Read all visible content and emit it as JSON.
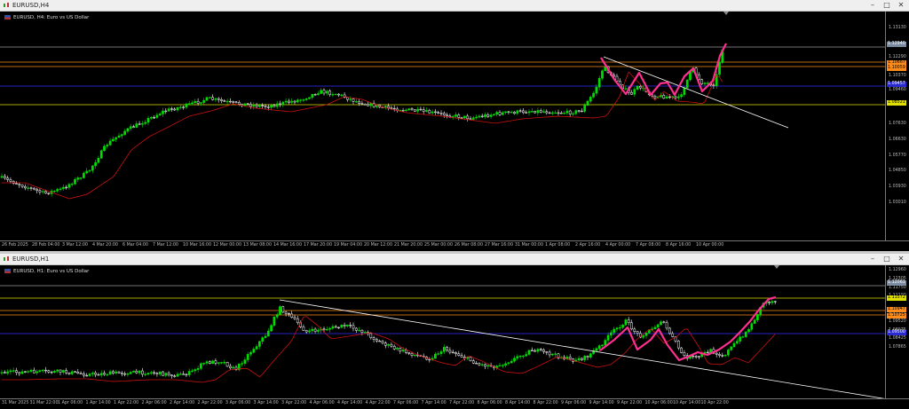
{
  "windows": [
    {
      "title": "EURUSD,H4",
      "legend": "EURUSD, H4: Euro vs US Dollar",
      "yticks": [
        "1.13130",
        "1.12290",
        "1.10370",
        "1.09460",
        "1.07630",
        "1.06630",
        "1.05770",
        "1.04850",
        "1.03930",
        "1.03010"
      ],
      "price_tags": [
        {
          "text": "1.12940",
          "bg": "#7a8aa0",
          "fg": "#ffffff"
        },
        {
          "text": "1.10667",
          "bg": "#ff8c1a",
          "fg": "#000000"
        },
        {
          "text": "1.10059",
          "bg": "#ff8c1a",
          "fg": "#000000"
        },
        {
          "text": "1.09457",
          "bg": "#2a2ad0",
          "fg": "#ffffff"
        },
        {
          "text": "1.08521",
          "bg": "#e0e000",
          "fg": "#000000"
        }
      ],
      "xticks": [
        "26 Feb 2025",
        "28 Feb 04:00",
        "3 Mar 12:00",
        "4 Mar 20:00",
        "6 Mar 04:00",
        "7 Mar 12:00",
        "10 Mar 16:00",
        "12 Mar 00:00",
        "13 Mar 08:00",
        "14 Mar 16:00",
        "17 Mar 20:00",
        "19 Mar 04:00",
        "20 Mar 12:00",
        "21 Mar 20:00",
        "25 Mar 00:00",
        "26 Mar 08:00",
        "27 Mar 16:00",
        "31 Mar 00:00",
        "1 Apr 08:00",
        "2 Apr 16:00",
        "4 Apr 00:00",
        "7 Apr 08:00",
        "8 Apr 16:00",
        "10 Apr 00:00"
      ]
    },
    {
      "title": "EURUSD,H1",
      "legend": "EURUSD, H1: Euro vs US Dollar",
      "yticks": [
        "1.12960",
        "1.12305",
        "1.11750",
        "1.11190",
        "1.10000",
        "1.09520",
        "1.08975",
        "1.08425",
        "1.07865"
      ],
      "price_tags": [
        {
          "text": "1.12061",
          "bg": "#7a8aa0",
          "fg": "#ffffff"
        },
        {
          "text": "1.11572",
          "bg": "#e0e000",
          "fg": "#000000"
        },
        {
          "text": "1.10947",
          "bg": "#ff8c1a",
          "fg": "#000000"
        },
        {
          "text": "1.10725",
          "bg": "#ff8c1a",
          "fg": "#000000"
        },
        {
          "text": "1.09500",
          "bg": "#2a2ad0",
          "fg": "#ffffff"
        }
      ],
      "xticks": [
        "31 Mar 2025",
        "31 Mar 22:00",
        "1 Apr 06:00",
        "1 Apr 14:00",
        "1 Apr 22:00",
        "2 Apr 06:00",
        "2 Apr 14:00",
        "2 Apr 22:00",
        "3 Apr 06:00",
        "3 Apr 14:00",
        "3 Apr 22:00",
        "4 Apr 06:00",
        "4 Apr 14:00",
        "4 Apr 22:00",
        "7 Apr 06:00",
        "7 Apr 14:00",
        "7 Apr 22:00",
        "8 Apr 06:00",
        "8 Apr 14:00",
        "8 Apr 22:00",
        "9 Apr 06:00",
        "9 Apr 14:00",
        "9 Apr 22:00",
        "10 Apr 06:00",
        "10 Apr 14:00",
        "10 Apr 22:00"
      ]
    }
  ],
  "colors": {
    "bull": "#00dd00",
    "bear": "#ffffff",
    "ma": "#cc1111",
    "pattern": "#ff2f8f",
    "trendline": "#ffffff",
    "resistance": "#e0e000",
    "orange": "#ff8c1a",
    "blue": "#3030ff",
    "grey": "#9a9a9a"
  },
  "icons": {
    "chart": "candlestick-icon",
    "minimize": "minimize-icon",
    "maximize": "maximize-icon",
    "close": "close-icon"
  }
}
